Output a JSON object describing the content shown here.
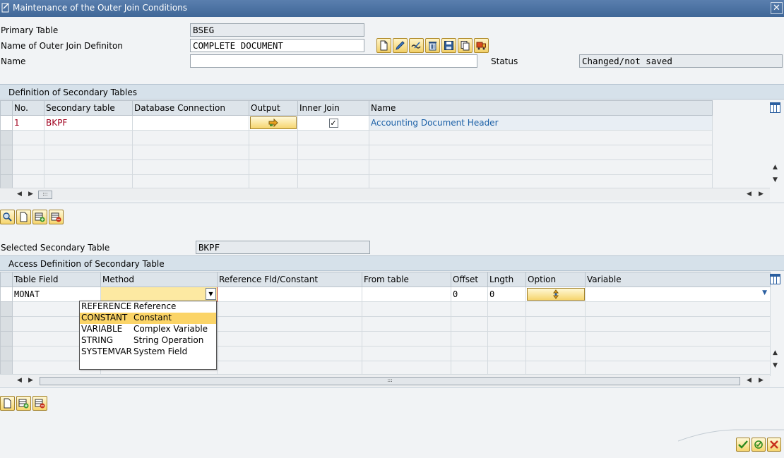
{
  "window": {
    "title": "Maintenance of the Outer Join Conditions"
  },
  "header": {
    "primary_table_label": "Primary Table",
    "primary_table_value": "BSEG",
    "outer_join_label": "Name of Outer Join Definiton",
    "outer_join_value": "COMPLETE DOCUMENT",
    "name_label": "Name",
    "name_value": "",
    "status_label": "Status",
    "status_value": "Changed/not saved"
  },
  "toolbar_icons": [
    "new-document-icon",
    "edit-pencil-icon",
    "display-change-icon",
    "delete-trash-icon",
    "save-disk-icon",
    "copy-icon",
    "transport-truck-icon"
  ],
  "secondary_tables": {
    "section_title": "Definition of Secondary Tables",
    "columns": [
      "No.",
      "Secondary table",
      "Database Connection",
      "Output",
      "Inner Join",
      "Name"
    ],
    "rows": [
      {
        "no": "1",
        "table": "BKPF",
        "db_connection": "",
        "inner_join": true,
        "name": "Accounting Document Header"
      }
    ]
  },
  "access_def": {
    "selected_label": "Selected Secondary Table",
    "selected_value": "BKPF",
    "section_title": "Access Definition of Secondary Table",
    "columns": [
      "Table Field",
      "Method",
      "Reference Fld/Constant",
      "From table",
      "Offset",
      "Lngth",
      "Option",
      "Variable"
    ],
    "rows": [
      {
        "field": "MONAT",
        "method": "",
        "ref": "",
        "from_table": "",
        "offset": "0",
        "length": "0",
        "variable": ""
      }
    ],
    "method_options": [
      {
        "key": "REFERENCE",
        "text": "Reference"
      },
      {
        "key": "CONSTANT",
        "text": "Constant"
      },
      {
        "key": "VARIABLE",
        "text": "Complex Variable"
      },
      {
        "key": "STRING",
        "text": "String Operation"
      },
      {
        "key": "SYSTEMVAR",
        "text": "System Field"
      }
    ],
    "highlighted_option_index": 1
  },
  "colors": {
    "accent_red": "#a0001e",
    "link_blue": "#1a5fa6",
    "title_bar": "#4a6f9f",
    "highlight": "#fbd467"
  }
}
